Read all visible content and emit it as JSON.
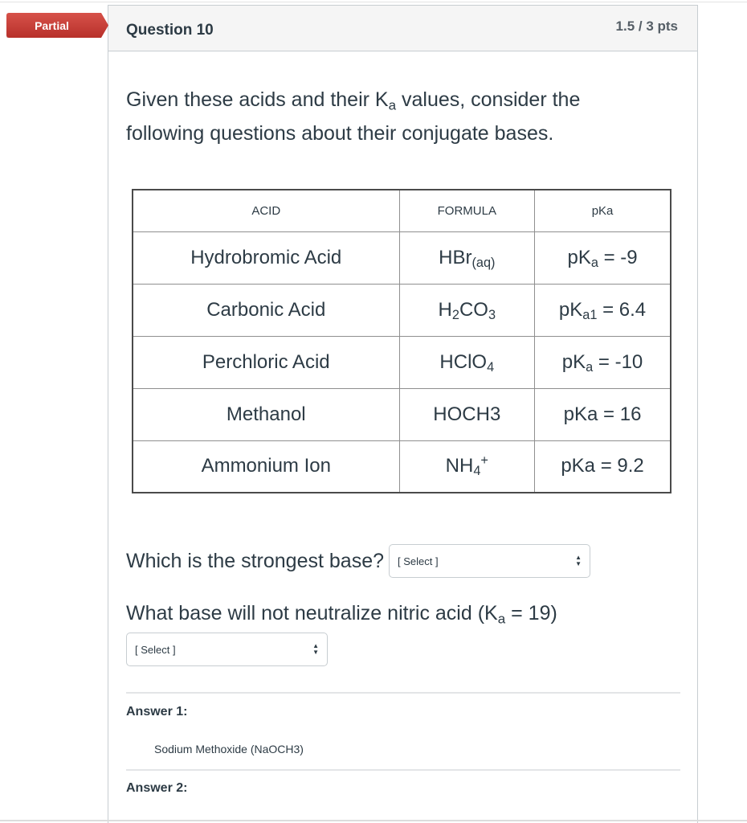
{
  "flag": {
    "label": "Partial",
    "color": "#c4403a"
  },
  "question": {
    "title": "Question 10",
    "points": "1.5 / 3 pts",
    "intro": {
      "before": "Given these acids and their K",
      "sub": "a",
      "after": " values, consider the following questions about their conjugate bases."
    }
  },
  "table": {
    "headers": [
      "ACID",
      "FORMULA",
      "pKa"
    ],
    "rows": [
      {
        "acid": "Hydrobromic Acid",
        "formula": {
          "main": "HBr",
          "sub": "(aq)",
          "tail": "",
          "sup": ""
        },
        "pka": {
          "prefix": "pK",
          "sub": "a",
          "suffix": " = -9"
        }
      },
      {
        "acid": "Carbonic Acid",
        "formula": {
          "main": "H",
          "sub": "2",
          "tail": "CO",
          "sub2": "3",
          "sup": ""
        },
        "pka": {
          "prefix": "pK",
          "sub": "a1",
          "suffix": " = 6.4"
        }
      },
      {
        "acid": "Perchloric Acid",
        "formula": {
          "main": "HClO",
          "sub": "4",
          "tail": "",
          "sup": ""
        },
        "pka": {
          "prefix": "pK",
          "sub": "a",
          "suffix": " = -10"
        }
      },
      {
        "acid": "Methanol",
        "formula": {
          "main": "HOCH3",
          "sub": "",
          "tail": "",
          "sup": ""
        },
        "pka": {
          "prefix": "pKa = 16",
          "sub": "",
          "suffix": ""
        }
      },
      {
        "acid": "Ammonium Ion",
        "formula": {
          "main": "NH",
          "sub": "4",
          "tail": "",
          "sup": "+"
        },
        "pka": {
          "prefix": "pKa = 9.2",
          "sub": "",
          "suffix": ""
        }
      }
    ]
  },
  "questions": {
    "q1": {
      "text": "Which is the strongest base?",
      "select_value": "[ Select ]"
    },
    "q2": {
      "before": "What base will not neutralize nitric acid (K",
      "sub": "a",
      "after": " = 19)",
      "select_value": "[ Select ]"
    }
  },
  "answers": [
    {
      "label": "Answer 1:",
      "value": "Sodium Methoxide (NaOCH3)"
    },
    {
      "label": "Answer 2:",
      "value": ""
    }
  ],
  "icons": {
    "select_arrows": "updown-arrows-icon"
  }
}
